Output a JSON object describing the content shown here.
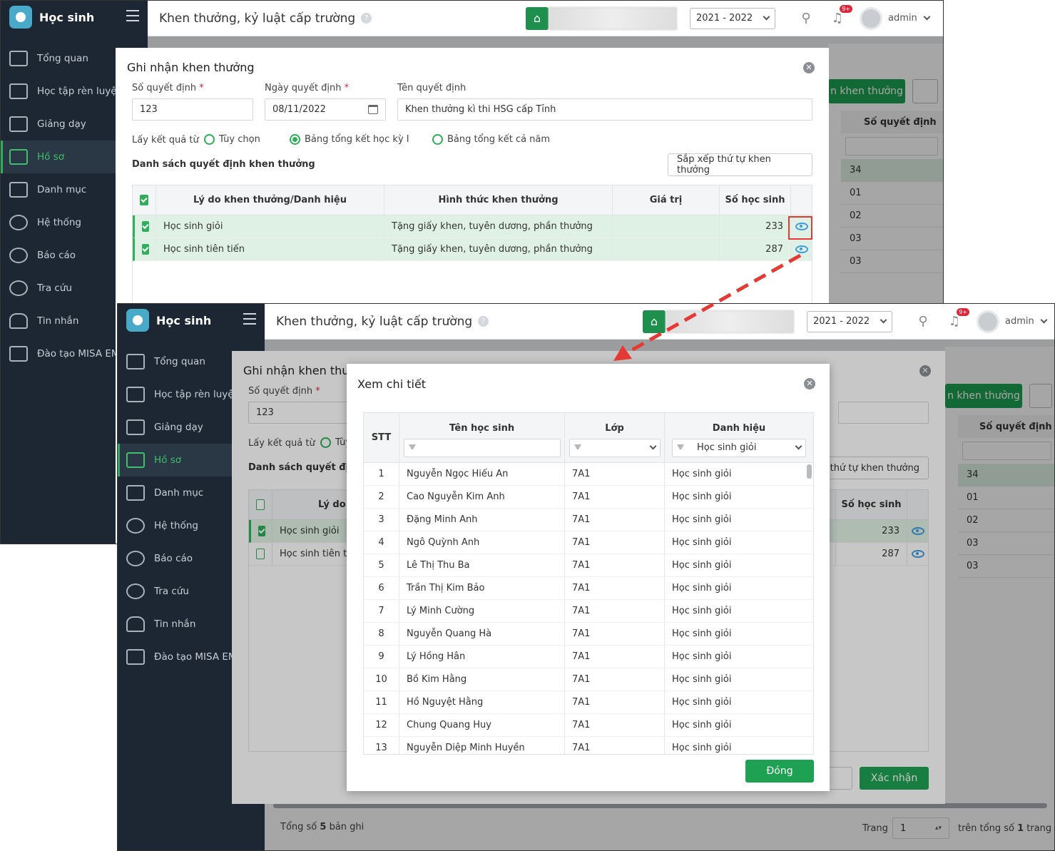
{
  "app": {
    "name": "Học sinh"
  },
  "nav": [
    {
      "label": "Tổng quan"
    },
    {
      "label": "Học tập rèn luyện"
    },
    {
      "label": "Giảng dạy"
    },
    {
      "label": "Hồ sơ"
    },
    {
      "label": "Danh mục"
    },
    {
      "label": "Hệ thống"
    },
    {
      "label": "Báo cáo"
    },
    {
      "label": "Tra cứu"
    },
    {
      "label": "Tin nhắn"
    },
    {
      "label": "Đào tạo MISA EMIS"
    }
  ],
  "topbar": {
    "title": "Khen thưởng, kỷ luật cấp trường",
    "help": "?",
    "year": "2021 - 2022",
    "badge": "9+",
    "user": "admin"
  },
  "background_page": {
    "add_button": "n khen thưởng",
    "column_header": "Số quyết định",
    "rows": [
      "34",
      "01",
      "02",
      "03",
      "03"
    ],
    "footer_total_prefix": "Tổng số",
    "footer_total_count": "5",
    "footer_total_suffix": "bản ghi",
    "page_label": "Trang",
    "page_value": "1",
    "page_total_prefix": "trên tổng số",
    "page_total_count": "1",
    "page_total_suffix": "trang"
  },
  "reward_dialog": {
    "title": "Ghi nhận khen thưởng",
    "decision_number_label": "Số quyết định",
    "decision_number": "123",
    "decision_date_label": "Ngày quyết định",
    "decision_date": "08/11/2022",
    "decision_name_label": "Tên quyết định",
    "decision_name": "Khen thưởng kì thi HSG cấp Tỉnh",
    "required_mark": "*",
    "result_source_label": "Lấy kết quả từ",
    "options": [
      "Tùy chọn",
      "Bảng tổng kết học kỳ I",
      "Bảng tổng kết cả năm"
    ],
    "list_title": "Danh sách quyết định khen thưởng",
    "sort_button": "Sắp xếp thứ tự khen thưởng",
    "columns": [
      "Lý do khen thưởng/Danh hiệu",
      "Hình thức khen thưởng",
      "Giá trị",
      "Số học sinh"
    ],
    "rows": [
      {
        "reason": "Học sinh giỏi",
        "form": "Tặng giấy khen, tuyên dương, phần thưởng",
        "value": "",
        "count": "233"
      },
      {
        "reason": "Học sinh tiên tiến",
        "form": "Tặng giấy khen, tuyên dương, phần thưởng",
        "value": "",
        "count": "287"
      }
    ],
    "confirm_button": "Xác nhận",
    "second_shot_reason_partial": "Lý do k",
    "second_shot_title_partial": "Ghi nhận khen thư",
    "second_shot_list_partial": "Danh sách quyết định",
    "second_shot_option_partial": "Tùy",
    "second_shot_sort_partial": "thứ tự khen thưởng",
    "second_shot_row2_partial": "Học sinh tiên tiế"
  },
  "detail_dialog": {
    "title": "Xem chi tiết",
    "columns": [
      "STT",
      "Tên học sinh",
      "Lớp",
      "Danh hiệu"
    ],
    "filter_title": "Học sinh giỏi",
    "close_button": "Đóng",
    "rows": [
      {
        "stt": "1",
        "name": "Nguyễn Ngọc Hiếu An",
        "class": "7A1",
        "title": "Học sinh giỏi"
      },
      {
        "stt": "2",
        "name": "Cao Nguyễn Kim Anh",
        "class": "7A1",
        "title": "Học sinh giỏi"
      },
      {
        "stt": "3",
        "name": "Đặng Minh Anh",
        "class": "7A1",
        "title": "Học sinh giỏi"
      },
      {
        "stt": "4",
        "name": "Ngô Quỳnh Anh",
        "class": "7A1",
        "title": "Học sinh giỏi"
      },
      {
        "stt": "5",
        "name": "Lê Thị Thu Ba",
        "class": "7A1",
        "title": "Học sinh giỏi"
      },
      {
        "stt": "6",
        "name": "Trần Thị Kim Bảo",
        "class": "7A1",
        "title": "Học sinh giỏi"
      },
      {
        "stt": "7",
        "name": "Lý Minh Cường",
        "class": "7A1",
        "title": "Học sinh giỏi"
      },
      {
        "stt": "8",
        "name": "Nguyễn Quang Hà",
        "class": "7A1",
        "title": "Học sinh giỏi"
      },
      {
        "stt": "9",
        "name": "Lý Hồng Hân",
        "class": "7A1",
        "title": "Học sinh giỏi"
      },
      {
        "stt": "10",
        "name": "Bồ Kim Hằng",
        "class": "7A1",
        "title": "Học sinh giỏi"
      },
      {
        "stt": "11",
        "name": "Hồ Nguyệt Hằng",
        "class": "7A1",
        "title": "Học sinh giỏi"
      },
      {
        "stt": "12",
        "name": "Chung Quang Huy",
        "class": "7A1",
        "title": "Học sinh giỏi"
      },
      {
        "stt": "13",
        "name": "Nguyễn Diệp Minh Huyền",
        "class": "7A1",
        "title": "Học sinh giỏi"
      }
    ]
  },
  "colors": {
    "sidebar": "#1c2733",
    "accent": "#1ea152",
    "highlight": "#e53935",
    "eye": "#3f9be0"
  }
}
